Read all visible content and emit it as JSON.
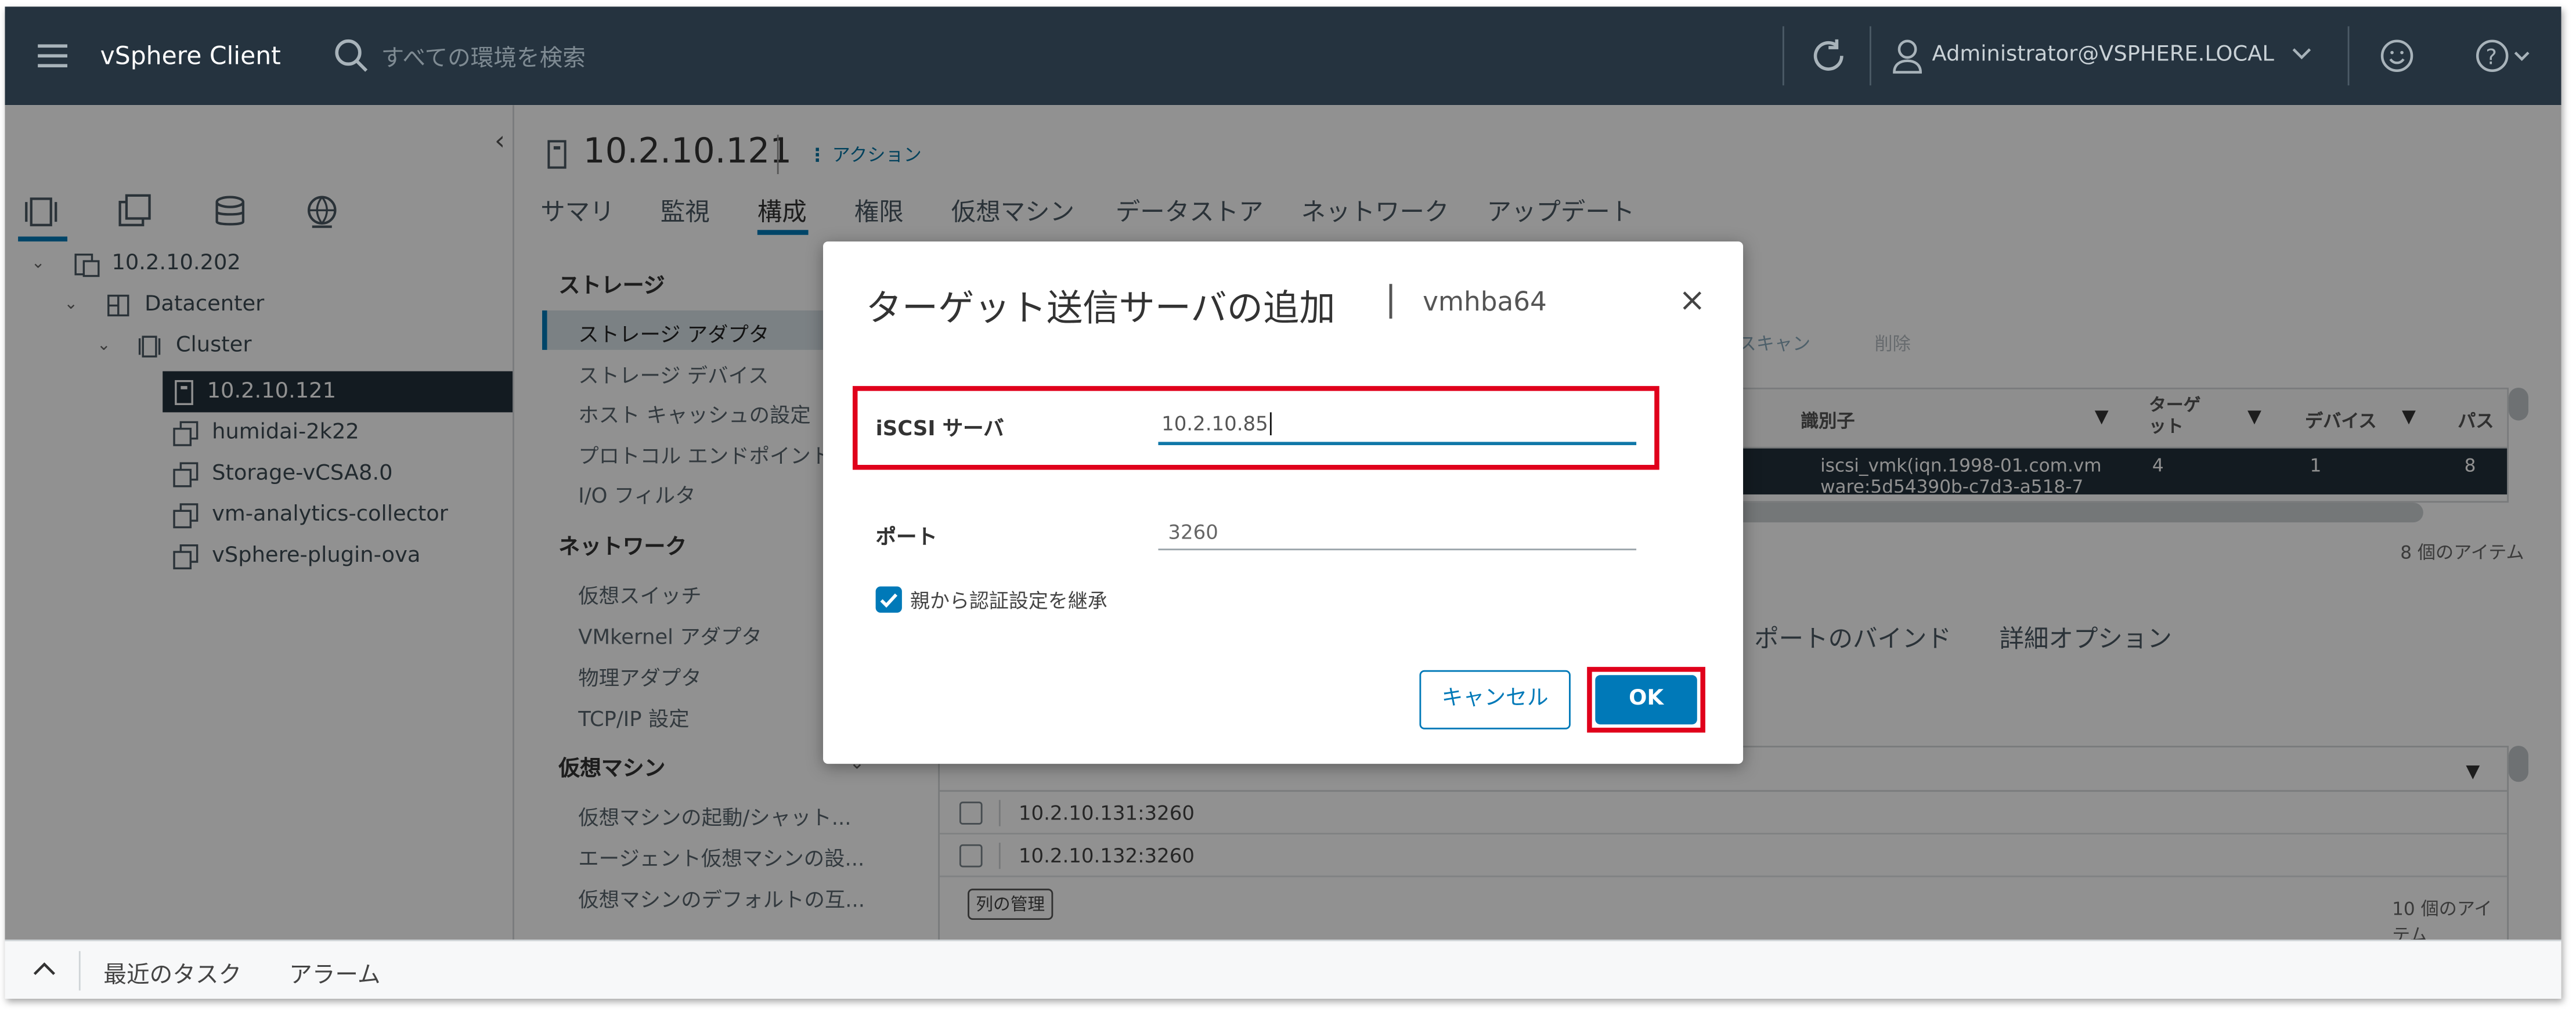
{
  "header": {
    "brand": "vSphere Client",
    "search_placeholder": "すべての環境を検索",
    "user": "Administrator@VSPHERE.LOCAL"
  },
  "navigator": {
    "tree": [
      {
        "label": "10.2.10.202"
      },
      {
        "label": "Datacenter"
      },
      {
        "label": "Cluster"
      },
      {
        "label": "10.2.10.121"
      },
      {
        "label": "humidai-2k22"
      },
      {
        "label": "Storage-vCSA8.0"
      },
      {
        "label": "vm-analytics-collector"
      },
      {
        "label": "vSphere-plugin-ova"
      }
    ]
  },
  "object": {
    "title": "10.2.10.121",
    "actions": "アクション"
  },
  "tabs": [
    "サマリ",
    "監視",
    "構成",
    "権限",
    "仮想マシン",
    "データストア",
    "ネットワーク",
    "アップデート"
  ],
  "side": {
    "storage_h": "ストレージ",
    "storage": [
      "ストレージ アダプタ",
      "ストレージ デバイス",
      "ホスト キャッシュの設定",
      "プロトコル エンドポイント",
      "I/O フィルタ"
    ],
    "network_h": "ネットワーク",
    "network": [
      "仮想スイッチ",
      "VMkernel アダプタ",
      "物理アダプタ",
      "TCP/IP 設定"
    ],
    "vm_h": "仮想マシン",
    "vm": [
      "仮想マシンの起動/シャット...",
      "エージェント仮想マシンの設...",
      "仮想マシンのデフォルトの互..."
    ]
  },
  "bg": {
    "rescan": "スキャン",
    "remove": "削除",
    "cols": [
      "識別子",
      "ターゲット",
      "デバイス",
      "パス"
    ],
    "row": {
      "id": "iscsi_vmk(iqn.1998-01.com.vm",
      "id2": "ware:5d54390b-c7d3-a518-7",
      "targets": "4",
      "devices": "1",
      "paths": "8"
    },
    "count1": "8 個のアイテム",
    "sub_tabs": [
      "ク ポートのバインド",
      "詳細オプション"
    ],
    "servers": [
      "10.2.10.131:3260",
      "10.2.10.132:3260"
    ],
    "manage": "列の管理",
    "count2": "10 個のアイテム"
  },
  "dialog": {
    "title": "ターゲット送信サーバの追加",
    "sep": "|",
    "subtitle": "vmhba64",
    "server_label": "iSCSI サーバ",
    "server_value": "10.2.10.85",
    "port_label": "ポート",
    "port_value": "3260",
    "inherit_label": "親から認証設定を継承",
    "cancel": "キャンセル",
    "ok": "OK"
  },
  "footer": {
    "recent": "最近のタスク",
    "alarms": "アラーム"
  },
  "colors": {
    "header": "#25333f",
    "accent": "#0079b8",
    "highlight": "#e0001b"
  }
}
